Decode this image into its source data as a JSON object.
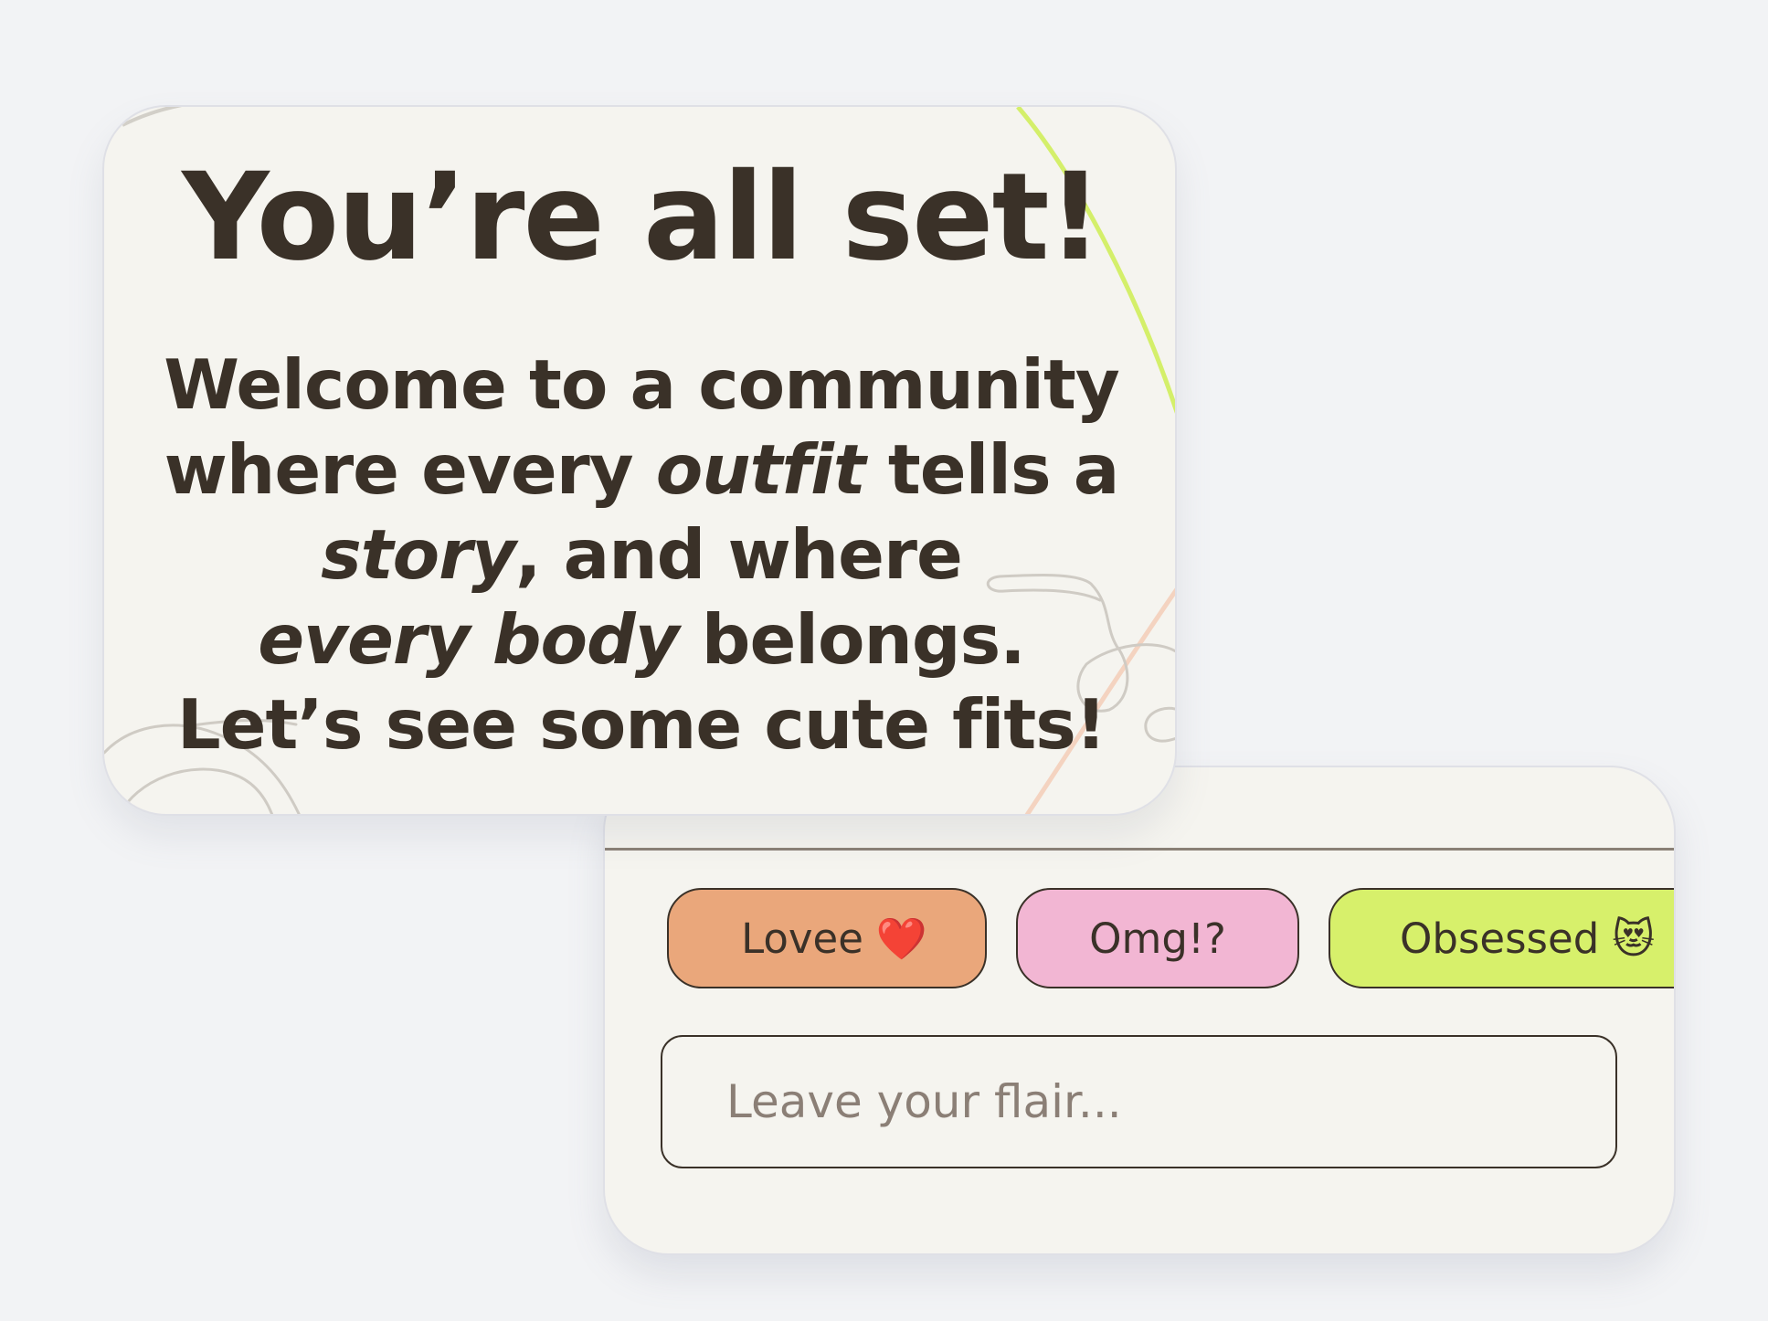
{
  "welcome_card": {
    "title": "You’re all set!",
    "message": {
      "line1": "Welcome to a community",
      "line2_before": "where every ",
      "line2_em": "outfit",
      "line2_after": " tells a",
      "line3_em": "story",
      "line3_after": ", and where",
      "line4_em": "every body",
      "line4_after": " belongs.",
      "line5": "Let’s see some cute fits!"
    },
    "colors": {
      "background": "#f5f4ef",
      "accent_arc": "#d4ef6a",
      "peach_arc": "#f4d3c0",
      "squiggle": "#cfcbc4"
    }
  },
  "reaction_card": {
    "reactions": [
      {
        "label": "Lovee",
        "emoji": "❤️",
        "color": "#eaa77b"
      },
      {
        "label": "Omg!?",
        "emoji": "",
        "color": "#f2b6d3"
      },
      {
        "label": "Obsessed",
        "emoji": "😻",
        "color": "#d7f06b"
      }
    ],
    "flair_input": {
      "placeholder": "Leave your flair...",
      "value": ""
    }
  }
}
